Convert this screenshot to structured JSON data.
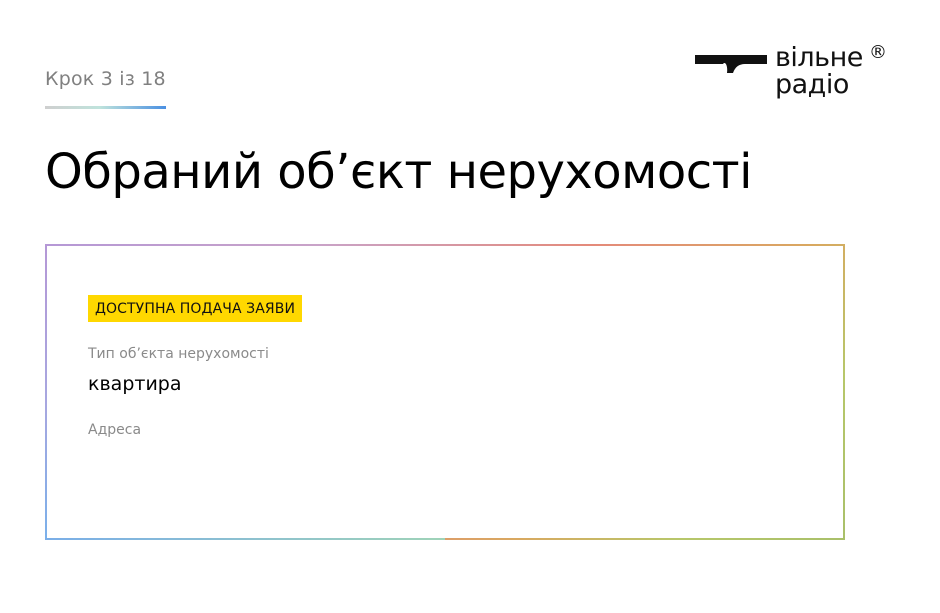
{
  "step": {
    "label": "Крок 3 із 18"
  },
  "logo": {
    "line1": "вільне",
    "line2": "радіо",
    "registered": "®"
  },
  "page": {
    "title": "Обраний об’єкт нерухомості"
  },
  "card": {
    "badge": "ДОСТУПНА ПОДАЧА ЗАЯВИ",
    "property_type_label": "Тип об’єкта нерухомості",
    "property_type_value": "квартира",
    "address_label": "Адреса",
    "address_value": ""
  },
  "colors": {
    "badge_bg": "#ffd800",
    "muted_text": "#8a8a8a",
    "step_text": "#808080",
    "accent_blue": "#4a90e2"
  }
}
